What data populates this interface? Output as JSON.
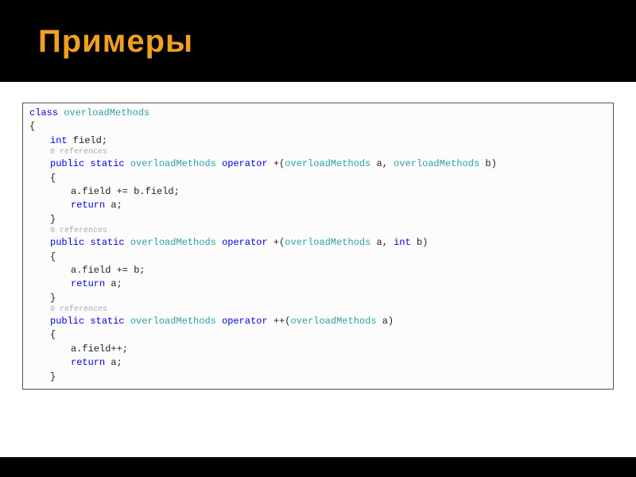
{
  "slide": {
    "title": "Примеры"
  },
  "code": {
    "l1": {
      "kw": "class",
      "type": "overloadMethods"
    },
    "l2": "{",
    "l3": {
      "kw": "int",
      "rest": " field;"
    },
    "ref": "0 references",
    "m1": {
      "pub": "public",
      "stat": "static",
      "type1": "overloadMethods",
      "op": "operator",
      "sig_open": " +(",
      "type2": "overloadMethods",
      "arg1": " a, ",
      "type3": "overloadMethods",
      "arg2": " b)"
    },
    "b_open": "{",
    "m1_body1": "a.field += b.field;",
    "ret": {
      "kw": "return",
      "rest": " a;"
    },
    "b_close": "}",
    "m2": {
      "pub": "public",
      "stat": "static",
      "type1": "overloadMethods",
      "op": "operator",
      "sig_open": " +(",
      "type2": "overloadMethods",
      "arg1": " a, ",
      "type_int": "int",
      "arg2": " b)"
    },
    "m2_body1": "a.field += b;",
    "m3": {
      "pub": "public",
      "stat": "static",
      "type1": "overloadMethods",
      "op": "operator",
      "sig_open": " ++(",
      "type2": "overloadMethods",
      "arg1": " a)"
    },
    "m3_body1": "a.field++;"
  }
}
